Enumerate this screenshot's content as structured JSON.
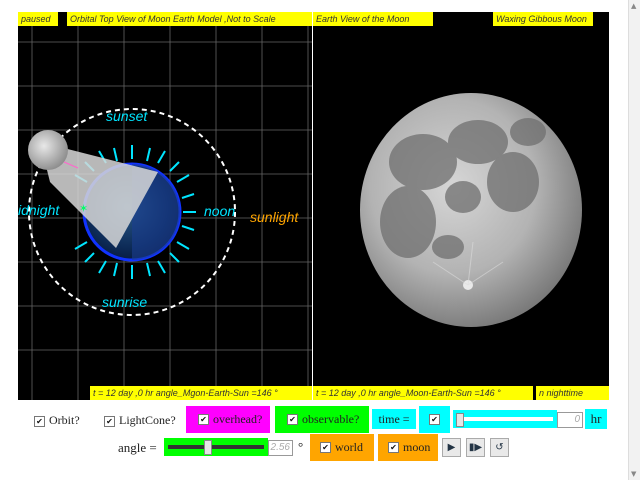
{
  "left_panel": {
    "status": "paused",
    "title": "Orbital Top View of Moon Earth Model ,Not to Scale",
    "labels": {
      "sunset": "sunset",
      "sunrise": "sunrise",
      "midnight": "idnight",
      "noon": "noon",
      "sunlight": "sunlight"
    },
    "footer": "t = 12 day ,0 hr angle_Mgon-Earth-Sun =146 °"
  },
  "right_panel": {
    "title": "Earth View of the Moon",
    "phase": "Waxing Gibbous Moon",
    "footer": "t = 12 day ,0 hr angle_Moon-Earth-Sun =146 °",
    "time_of_day": "n nighttime"
  },
  "controls": {
    "orbit": {
      "label": "Orbit?",
      "checked": true
    },
    "lightcone": {
      "label": "LightCone?",
      "checked": true
    },
    "overhead": {
      "label": "overhead?",
      "checked": true
    },
    "observable": {
      "label": "observable?",
      "checked": true
    },
    "time_label": "time =",
    "time_value": "0",
    "time_unit": "hr",
    "angle_label": "angle =",
    "angle_value": "2.56",
    "angle_unit": "°",
    "world": {
      "label": "world",
      "checked": true
    },
    "moon": {
      "label": "moon",
      "checked": true
    },
    "check_mark": "✔"
  },
  "colors": {
    "yellow": "#ffff00",
    "cyan": "#00ffff",
    "magenta": "#ff00ff",
    "green": "#00ff00",
    "orange": "#ffa500"
  },
  "icons": {
    "play": "play-icon",
    "step": "step-forward-icon",
    "reset": "reset-icon"
  }
}
